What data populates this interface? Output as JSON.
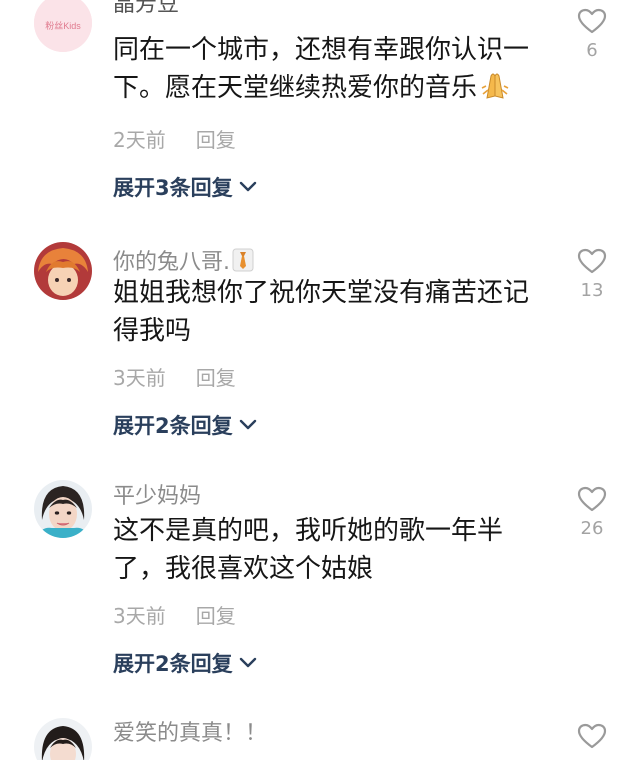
{
  "comments": [
    {
      "username": "晶芳豆",
      "avatar_icon": "avatar-badge-icon",
      "avatar_badge_text": "粉丝Kids",
      "text_lines": [
        "同在一个城市，还想有幸跟你认识一",
        "下。愿在天堂继续热爱你的音乐"
      ],
      "text_emoji": "folded-hands-icon",
      "time": "2天前",
      "reply_label": "回复",
      "expand_label": "展开3条回复",
      "likes": "6"
    },
    {
      "username": "你的兔八哥.",
      "username_badge": "tie-icon",
      "avatar_icon": "anime-avatar-icon",
      "text_lines": [
        "姐姐我想你了祝你天堂没有痛苦还记",
        "得我吗"
      ],
      "time": "3天前",
      "reply_label": "回复",
      "expand_label": "展开2条回复",
      "likes": "13"
    },
    {
      "username": "平少妈妈",
      "avatar_icon": "photo-avatar-icon",
      "text_lines": [
        "这不是真的吧，我听她的歌一年半",
        "了，我很喜欢这个姑娘"
      ],
      "time": "3天前",
      "reply_label": "回复",
      "expand_label": "展开2条回复",
      "likes": "26"
    },
    {
      "username": "爱笑的真真！！",
      "avatar_icon": "photo-avatar-icon",
      "likes": ""
    }
  ],
  "colors": {
    "text": "#161616",
    "username": "#8b8b8b",
    "meta": "#a8a8a8",
    "expand": "#2a3f5c",
    "like_outline": "#9a9a9a"
  }
}
